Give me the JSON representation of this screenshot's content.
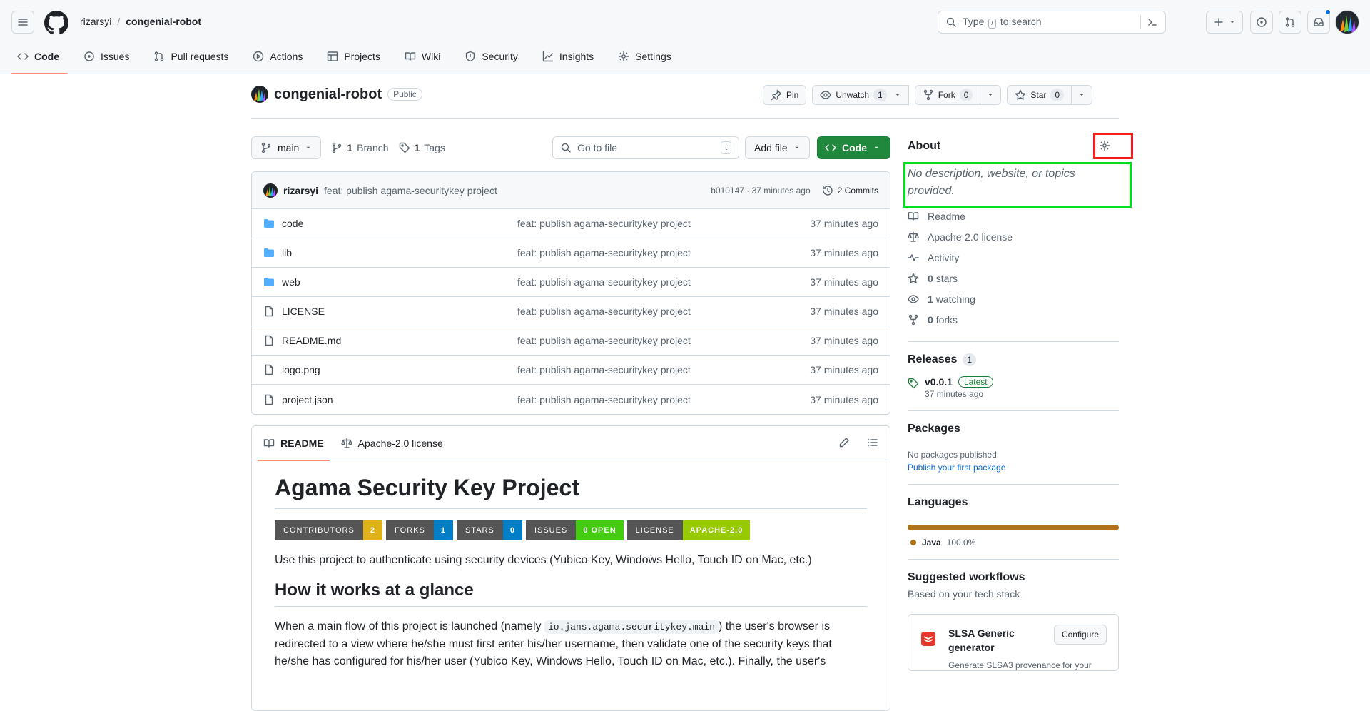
{
  "header": {
    "owner": "rizarsyi",
    "separator": "/",
    "repo": "congenial-robot",
    "search_pre": "Type",
    "search_key": "/",
    "search_post": "to search"
  },
  "nav": {
    "tabs": [
      {
        "label": "Code",
        "icon": "code-icon"
      },
      {
        "label": "Issues",
        "icon": "issue-icon"
      },
      {
        "label": "Pull requests",
        "icon": "pull-request-icon"
      },
      {
        "label": "Actions",
        "icon": "play-icon"
      },
      {
        "label": "Projects",
        "icon": "table-icon"
      },
      {
        "label": "Wiki",
        "icon": "book-icon"
      },
      {
        "label": "Security",
        "icon": "shield-icon"
      },
      {
        "label": "Insights",
        "icon": "graph-icon"
      },
      {
        "label": "Settings",
        "icon": "gear-icon"
      }
    ]
  },
  "repo": {
    "name": "congenial-robot",
    "visibility": "Public",
    "pin_label": "Pin",
    "watch_label": "Unwatch",
    "watch_count": "1",
    "fork_label": "Fork",
    "fork_count": "0",
    "star_label": "Star",
    "star_count": "0"
  },
  "toolbar": {
    "branch": "main",
    "branches_count": "1",
    "branches_label": "Branch",
    "tags_count": "1",
    "tags_label": "Tags",
    "goto_placeholder": "Go to file",
    "goto_key": "t",
    "add_file": "Add file",
    "code": "Code"
  },
  "commit": {
    "author": "rizarsyi",
    "message": "feat: publish agama-securitykey project",
    "sha_time": "b010147 · 37 minutes ago",
    "commits": "2 Commits"
  },
  "files": [
    {
      "name": "code",
      "type": "folder",
      "msg": "feat: publish agama-securitykey project",
      "time": "37 minutes ago"
    },
    {
      "name": "lib",
      "type": "folder",
      "msg": "feat: publish agama-securitykey project",
      "time": "37 minutes ago"
    },
    {
      "name": "web",
      "type": "folder",
      "msg": "feat: publish agama-securitykey project",
      "time": "37 minutes ago"
    },
    {
      "name": "LICENSE",
      "type": "file",
      "msg": "feat: publish agama-securitykey project",
      "time": "37 minutes ago"
    },
    {
      "name": "README.md",
      "type": "file",
      "msg": "feat: publish agama-securitykey project",
      "time": "37 minutes ago"
    },
    {
      "name": "logo.png",
      "type": "file",
      "msg": "feat: publish agama-securitykey project",
      "time": "37 minutes ago"
    },
    {
      "name": "project.json",
      "type": "file",
      "msg": "feat: publish agama-securitykey project",
      "time": "37 minutes ago"
    }
  ],
  "readme": {
    "tab_readme": "README",
    "tab_license": "Apache-2.0 license",
    "title": "Agama Security Key Project",
    "badges": [
      {
        "label": "CONTRIBUTORS",
        "value": "2",
        "color": "#dfb317"
      },
      {
        "label": "FORKS",
        "value": "1",
        "color": "#007ec6"
      },
      {
        "label": "STARS",
        "value": "0",
        "color": "#007ec6"
      },
      {
        "label": "ISSUES",
        "value": "0 OPEN",
        "color": "#4c1"
      },
      {
        "label": "LICENSE",
        "value": "APACHE-2.0",
        "color": "#97ca00"
      }
    ],
    "intro": "Use this project to authenticate using security devices (Yubico Key, Windows Hello, Touch ID on Mac, etc.)",
    "h2": "How it works at a glance",
    "p2_a": "When a main flow of this project is launched (namely",
    "p2_code": "io.jans.agama.securitykey.main",
    "p2_b": ") the user's browser is redirected to a view where he/she must first enter his/her username, then validate one of the security keys that he/she has configured for his/her user (Yubico Key, Windows Hello, Touch ID on Mac, etc.). Finally, the user's"
  },
  "about": {
    "title": "About",
    "description": "No description, website, or topics provided.",
    "items": [
      {
        "icon": "book-icon",
        "bold": "",
        "text": "Readme"
      },
      {
        "icon": "law-icon",
        "bold": "",
        "text": "Apache-2.0 license"
      },
      {
        "icon": "pulse-icon",
        "bold": "",
        "text": "Activity"
      },
      {
        "icon": "star-icon",
        "bold": "0",
        "text": "stars"
      },
      {
        "icon": "eye-icon",
        "bold": "1",
        "text": "watching"
      },
      {
        "icon": "fork-icon",
        "bold": "0",
        "text": "forks"
      }
    ]
  },
  "releases": {
    "title": "Releases",
    "count": "1",
    "version": "v0.0.1",
    "latest": "Latest",
    "time": "37 minutes ago"
  },
  "packages": {
    "title": "Packages",
    "none": "No packages published",
    "link": "Publish your first package"
  },
  "languages": {
    "title": "Languages",
    "name": "Java",
    "percent": "100.0%",
    "color": "#b07219"
  },
  "workflows": {
    "title": "Suggested workflows",
    "subtitle": "Based on your tech stack",
    "card_title": "SLSA Generic generator",
    "card_desc": "Generate SLSA3 provenance for your",
    "configure": "Configure"
  }
}
